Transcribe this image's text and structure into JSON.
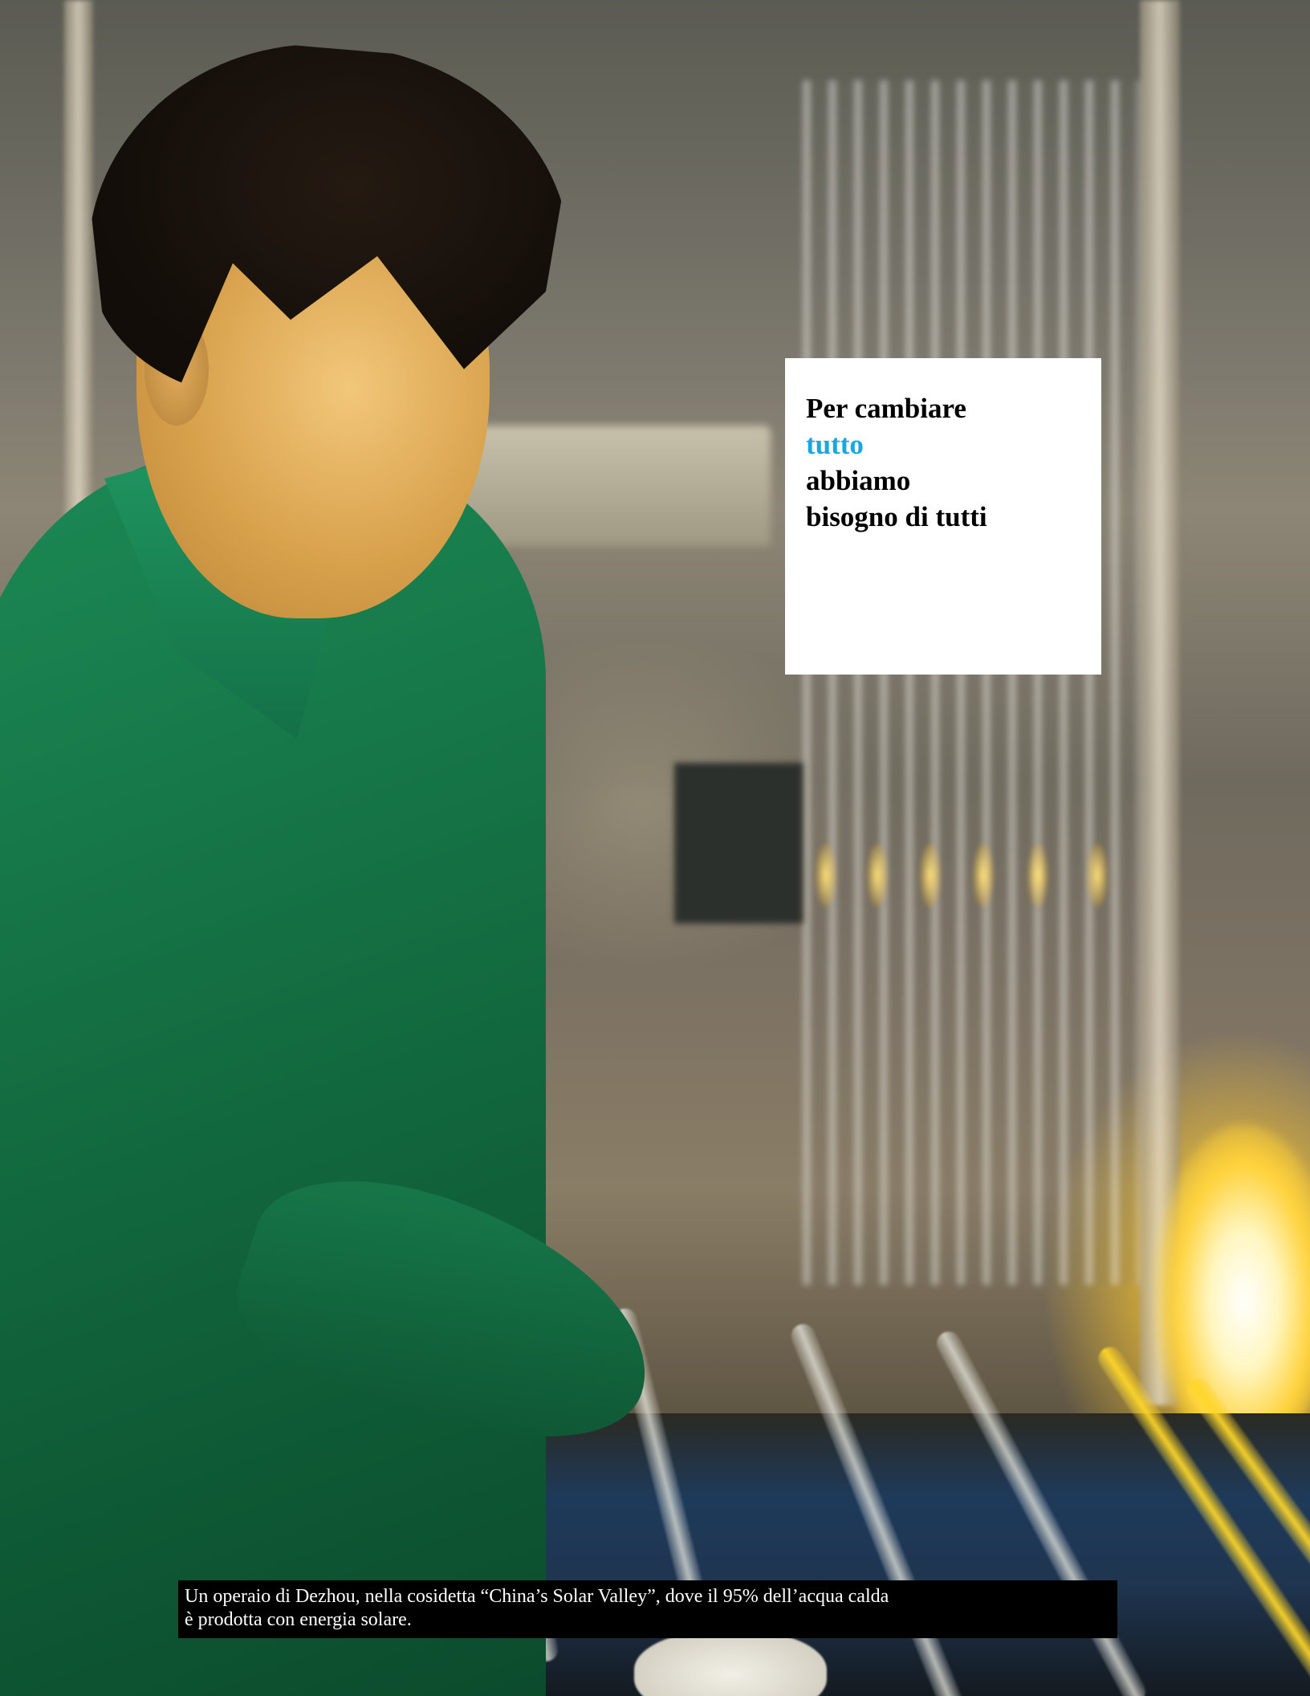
{
  "headline": {
    "lines": [
      {
        "text": "Per cambiare",
        "accent": false
      },
      {
        "text": "tutto",
        "accent": true
      },
      {
        "text": "abbiamo",
        "accent": false
      },
      {
        "text": "bisogno di tutti",
        "accent": false
      }
    ],
    "accent_color": "#1aa7e0",
    "text_color": "#000000",
    "box_color": "#ffffff"
  },
  "caption": {
    "lines": [
      "Un operaio di Dezhou, nella cosidetta “China’s Solar  Valley”, dove il 95%  dell’acqua calda",
      "è prodotta con energia    solare."
    ],
    "text_color": "#ffffff",
    "box_color": "#000000"
  },
  "photo": {
    "subject_icon": "factory-worker-photo",
    "dominant_colors": [
      "#157345",
      "#7c7263",
      "#ffd23a"
    ]
  }
}
